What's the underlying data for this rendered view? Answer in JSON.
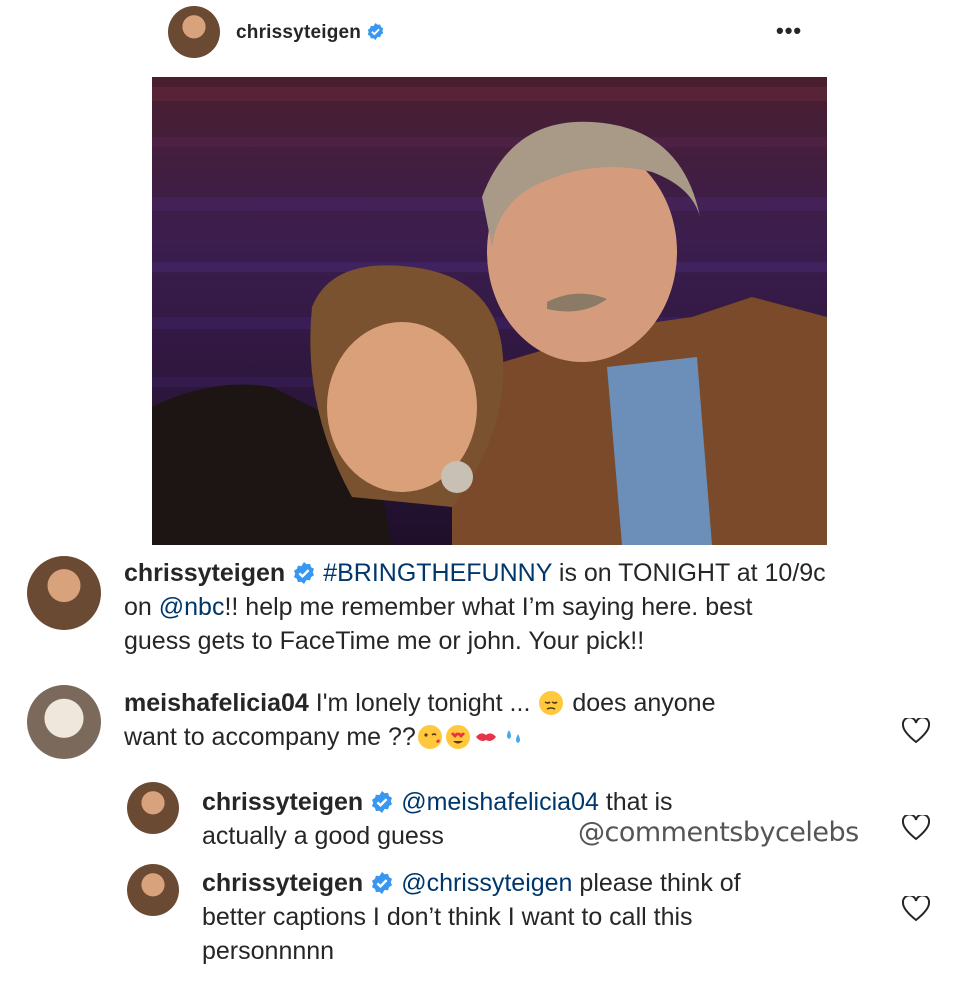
{
  "post": {
    "username": "chrissyteigen",
    "more_icon": "more-horizontal-icon",
    "caption": {
      "username": "chrissyteigen",
      "hashtag": "#BRINGTHEFUNNY",
      "line1_rest": " is on TONIGHT at 10/9c",
      "line2_pre": "on ",
      "mention": "@nbc",
      "line2_rest": "!! help me remember what I’m saying here. best",
      "line3": "guess gets to FaceTime me or john. Your pick!!"
    }
  },
  "comments": [
    {
      "username": "meishafelicia04",
      "line1": "I'm lonely tonight ...",
      "line1_after": "does anyone",
      "line2": "want to accompany me ??",
      "emojis": [
        "pensive-face",
        "face-blowing-kiss",
        "heart-eyes",
        "kiss-mark",
        "sweat-droplets"
      ]
    },
    {
      "username": "chrissyteigen",
      "mention": "@meishafelicia04",
      "line1_rest": " that is",
      "line2": "actually a good guess"
    },
    {
      "username": "chrissyteigen",
      "mention": "@chrissyteigen",
      "line1_rest": " please think of",
      "line2": "better captions I don’t think I want to call this",
      "line3": "personnnnn"
    }
  ],
  "watermark": "@commentsbycelebs"
}
